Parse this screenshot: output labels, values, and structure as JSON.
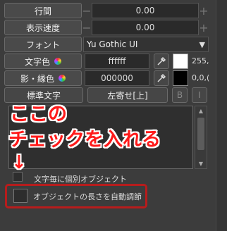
{
  "panel": {
    "line_spacing_label": "行間",
    "line_spacing_value": "0.00",
    "display_speed_label": "表示速度",
    "display_speed_value": "0.00",
    "font_label": "フォント",
    "font_value": "Yu Gothic UI",
    "text_color_label": "文字色",
    "text_color_value": "ffffff",
    "text_color_rgb": "255,",
    "shadow_color_label": "影・縁色",
    "shadow_color_value": "000000",
    "shadow_color_rgb": "0,0,(",
    "style_button": "標準文字",
    "align_button": "左寄せ[上]",
    "bold_button": "B",
    "italic_button": "I",
    "per_char_label": "文字毎に個別オブジェクト",
    "auto_length_label": "オブジェクトの長さを自動調節",
    "minus": "−",
    "plus": "+",
    "dropdown_arrow": "▼",
    "scroll_up": "▲",
    "scroll_down": "▼"
  },
  "annotation": {
    "line1": "ここの",
    "line2": "チェックを入れる",
    "arrow": "↓",
    "color": "#ff1a1a"
  }
}
